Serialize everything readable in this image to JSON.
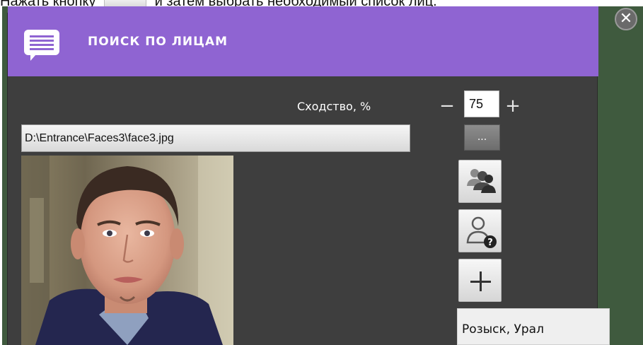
{
  "caption": {
    "before": "Нажать кнопку",
    "after": "и затем выбрать необходимый список лиц."
  },
  "panel": {
    "title": "ПОИСК ПО ЛИЦАМ",
    "close_symbol": "✕",
    "header_color": "#8f64d2",
    "background_color": "#3e3e3e"
  },
  "similarity": {
    "label": "Сходство, %",
    "value": "75",
    "decrement_symbol": "−",
    "increment_symbol": "+"
  },
  "file": {
    "path": "D:\\Entrance\\Faces3\\face3.jpg",
    "browse_label": "..."
  },
  "icons": {
    "header": "chat-list-icon",
    "people": "people-group-icon",
    "unknown_person": "person-question-icon",
    "add": "plus-icon"
  },
  "face_lists": [
    "Розыск, Урал"
  ]
}
